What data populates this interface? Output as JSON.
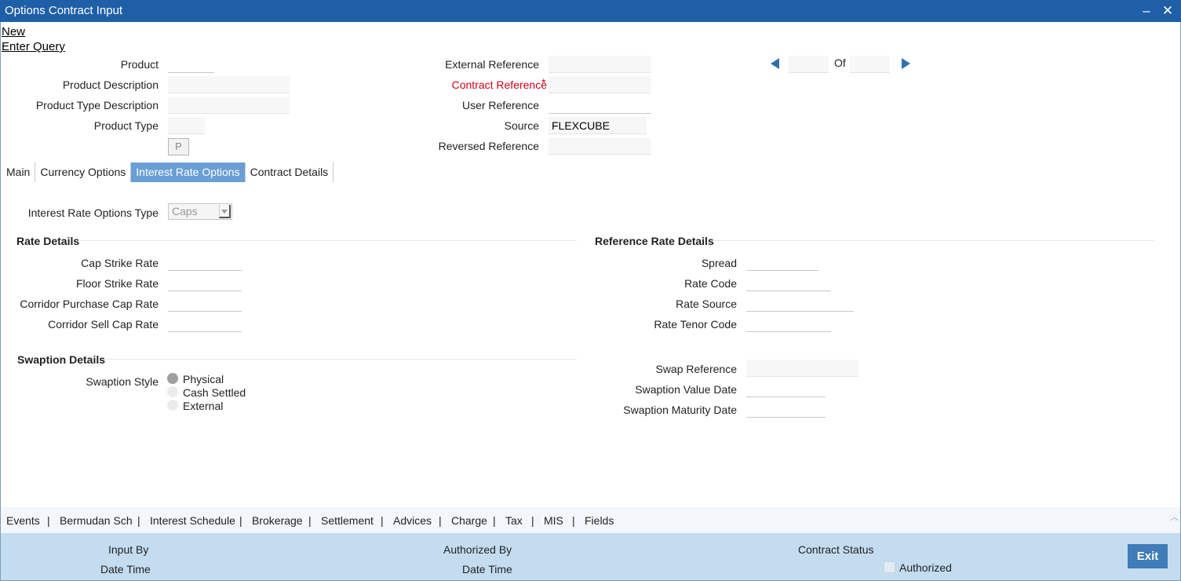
{
  "window": {
    "title": "Options Contract Input",
    "minimize": "–",
    "close": "✕"
  },
  "menu": {
    "new": "New",
    "enter_query": "Enter Query"
  },
  "header": {
    "product_label": "Product",
    "product_value": "",
    "product_description_label": "Product Description",
    "product_type_description_label": "Product Type Description",
    "product_type_label": "Product Type",
    "p_button": "P",
    "external_reference_label": "External Reference",
    "contract_reference_label": "Contract Reference",
    "contract_reference_required": "*",
    "user_reference_label": "User Reference",
    "source_label": "Source",
    "source_value": "FLEXCUBE",
    "reversed_reference_label": "Reversed Reference",
    "pager_of": "Of"
  },
  "tabs": [
    "Main",
    "Currency Options",
    "Interest Rate Options",
    "Contract Details"
  ],
  "active_tab": "Interest Rate Options",
  "interest_rate": {
    "options_type_label": "Interest Rate Options Type",
    "options_type_value": "Caps"
  },
  "rate_details": {
    "title": "Rate Details",
    "cap_strike_rate": "Cap Strike Rate",
    "floor_strike_rate": "Floor Strike Rate",
    "corridor_purchase_cap_rate": "Corridor Purchase Cap Rate",
    "corridor_sell_cap_rate": "Corridor Sell Cap Rate"
  },
  "reference_rate_details": {
    "title": "Reference Rate Details",
    "spread": "Spread",
    "rate_code": "Rate Code",
    "rate_source": "Rate Source",
    "rate_tenor_code": "Rate Tenor Code"
  },
  "swaption_details": {
    "title": "Swaption Details",
    "style_label": "Swaption Style",
    "options": [
      "Physical",
      "Cash Settled",
      "External"
    ],
    "selected": "Physical",
    "swap_reference": "Swap Reference",
    "swaption_value_date": "Swaption Value Date",
    "swaption_maturity_date": "Swaption Maturity Date"
  },
  "bottom_links": [
    "Events",
    "Bermudan Sch",
    "Interest Schedule",
    "Brokerage",
    "Settlement",
    "Advices",
    "Charge",
    "Tax",
    "MIS",
    "Fields"
  ],
  "footer": {
    "input_by": "Input By",
    "date_time_1": "Date Time",
    "authorized_by": "Authorized By",
    "date_time_2": "Date Time",
    "contract_status": "Contract Status",
    "authorized": "Authorized",
    "exit": "Exit"
  },
  "colors": {
    "titlebar": "#1f5fa8",
    "active_tab": "#6a9ed6",
    "footer": "#c4dcef",
    "exit_button": "#3f7cb8",
    "required": "#d0021b"
  }
}
